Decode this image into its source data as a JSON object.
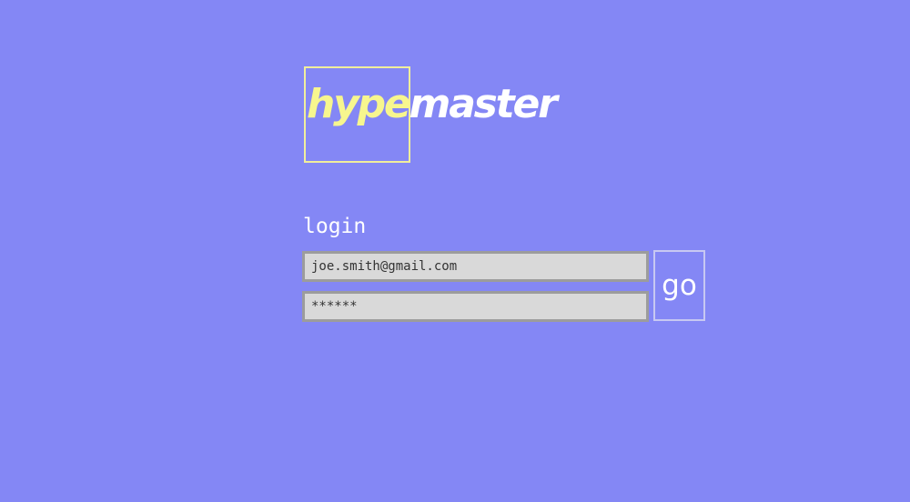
{
  "logo": {
    "part1": "hype",
    "part2": "master"
  },
  "login": {
    "label": "login",
    "email_value": "joe.smith@gmail.com",
    "password_value": "******",
    "submit_label": "go"
  },
  "colors": {
    "background": "#8487f5",
    "logo_accent": "#f7f68e",
    "logo_box_border": "#f0ee9c",
    "field_background": "#d9d9d9",
    "field_border": "#9c9c9c",
    "button_border": "#c7c8f2",
    "text_light": "#ffffff"
  }
}
